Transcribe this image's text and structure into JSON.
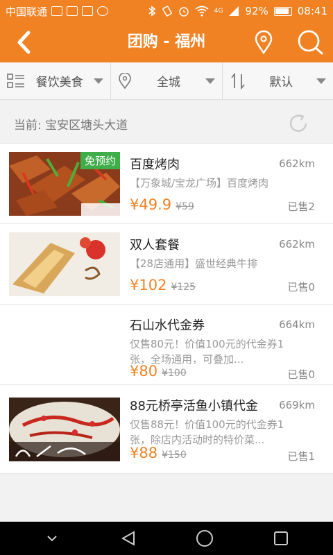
{
  "status_bar": {
    "carrier": "中国联通",
    "network": "4G",
    "battery": "92%",
    "time": "08:41",
    "icons": [
      "image-icon",
      "notification-icon",
      "upload-icon",
      "weather-icon",
      "bluetooth-icon",
      "rotate-icon",
      "alarm-icon",
      "wifi-icon",
      "signal-icon",
      "battery-icon"
    ]
  },
  "header": {
    "title": "团购 - 福州",
    "icons": [
      "back-arrow-icon",
      "location-pin-icon",
      "search-icon"
    ]
  },
  "filters": [
    {
      "label": "餐饮美食",
      "icon": "grid-list-icon"
    },
    {
      "label": "全城",
      "icon": "location-pin-icon"
    },
    {
      "label": "默认",
      "icon": "sort-icon"
    }
  ],
  "location": {
    "text": "当前: 宝安区塘头大道",
    "icon": "refresh-icon"
  },
  "items": [
    {
      "title": "百度烤肉",
      "distance": "662km",
      "desc": "【万象城/宝龙广场】百度烤肉",
      "price": "¥49.9",
      "orig": "¥59",
      "sold": "已售2",
      "badge": "免预约",
      "image": "grilled-meat-photo"
    },
    {
      "title": "双人套餐",
      "distance": "662km",
      "desc": "【28店通用】盛世经典牛排",
      "price": "¥102",
      "orig": "¥125",
      "sold": "已售0",
      "image": "steak-photo"
    },
    {
      "title": "石山水代金券",
      "distance": "664km",
      "desc": "仅售80元！价值100元的代金券1张，全场通用，可叠加...",
      "price": "¥80",
      "orig": "¥100",
      "sold": "已售0"
    },
    {
      "title": "88元桥亭活鱼小镇代金",
      "distance": "669km",
      "desc": "仅售88元！价值100元的代金券1张，除店内活动时的特价菜...",
      "price": "¥88",
      "orig": "¥150",
      "sold": "已售1",
      "image": "fish-dish-photo"
    }
  ],
  "nav": {
    "icons": [
      "collapse-icon",
      "back-icon",
      "home-icon",
      "recents-icon"
    ]
  },
  "colors": {
    "accent": "#f08224",
    "badge": "#3fae4a",
    "navbar": "#000000"
  }
}
